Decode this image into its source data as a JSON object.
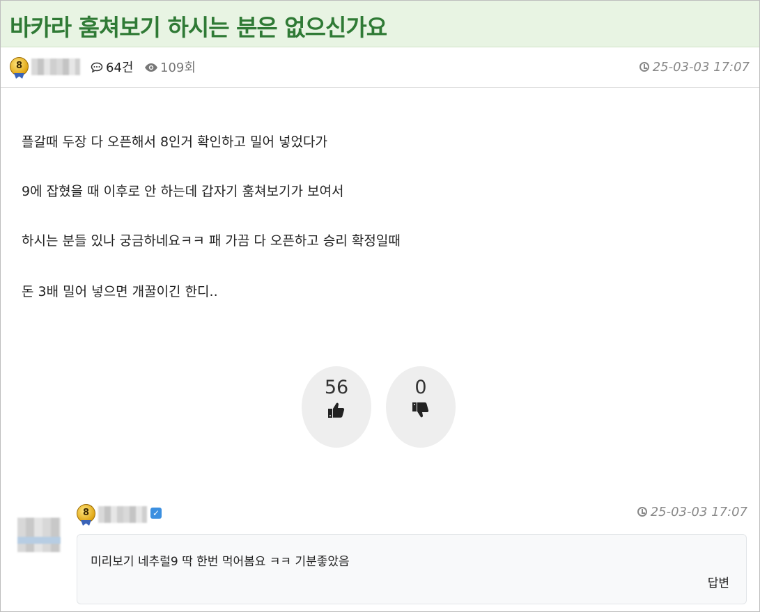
{
  "post": {
    "title": "바카라 훔쳐보기 하시는 분은 없으신가요",
    "author_level": "8",
    "comment_count": "64건",
    "view_count": "109회",
    "date": "25-03-03 17:07",
    "body": [
      "플갈때 두장 다 오픈해서 8인거 확인하고 밀어 넣었다가",
      "9에 잡혔을 때 이후로 안 하는데 갑자기 훔쳐보기가 보여서",
      "하시는 분들 있나 궁금하네요ㅋㅋ 패 가끔 다 오픈하고 승리 확정일때",
      "돈 3배 밀어 넣으면 개꿀이긴 한디.."
    ]
  },
  "votes": {
    "like_count": "56",
    "dislike_count": "0"
  },
  "comment": {
    "author_level": "8",
    "date": "25-03-03 17:07",
    "text": "미리보기 네추럴9 딱 한번 먹어봄요 ㅋㅋ 기분좋았음",
    "reply_label": "답변"
  },
  "icons": {
    "comment": "comment-icon",
    "view": "eye-icon",
    "clock": "clock-icon",
    "like": "thumbs-up-icon",
    "dislike": "thumbs-down-icon",
    "verified": "verified-check-icon"
  },
  "colors": {
    "title_bg": "#e8f4e3",
    "title_text": "#2f7a35",
    "vote_bg": "#eeeeee",
    "verified": "#3b8fe0"
  }
}
